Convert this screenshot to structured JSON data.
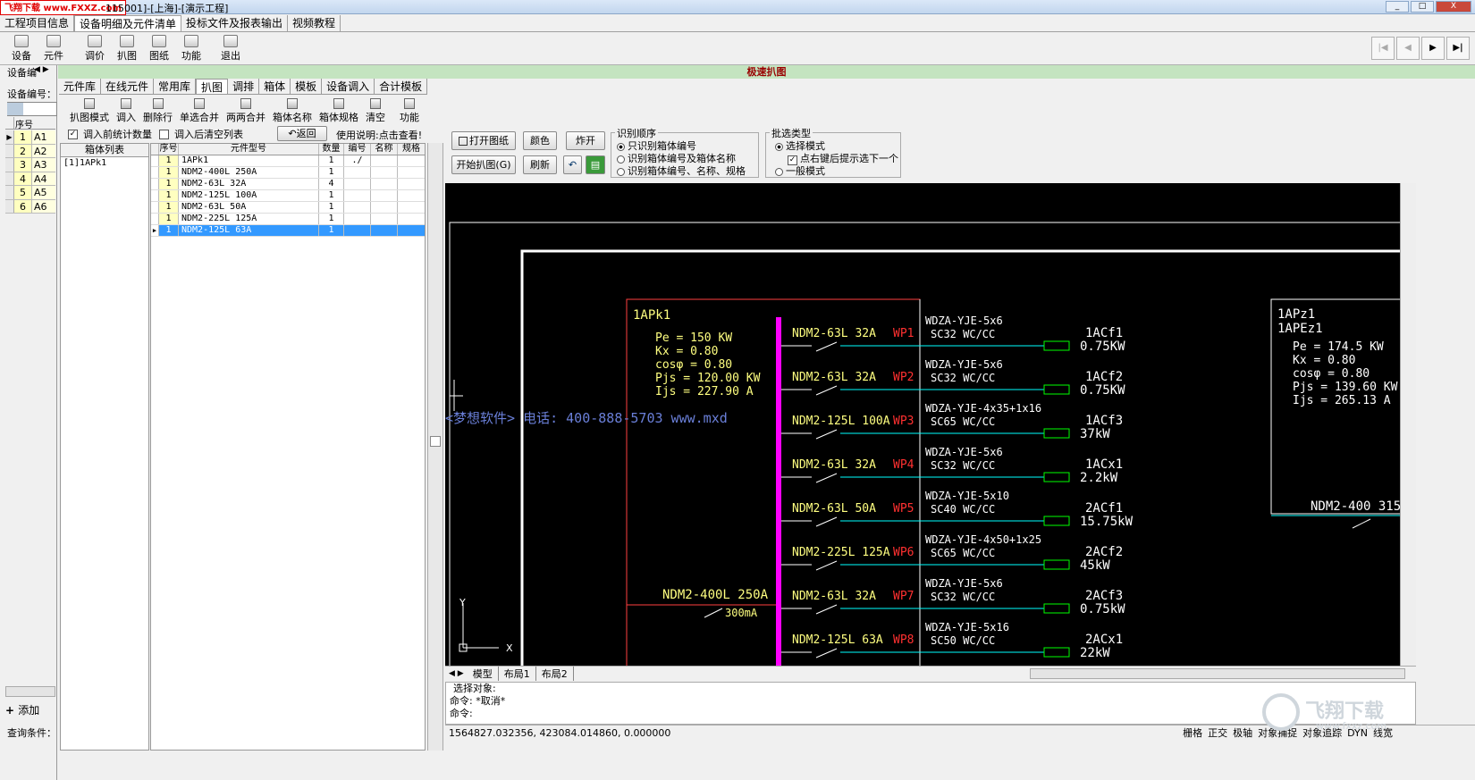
{
  "window": {
    "watermark": "飞翔下载 www.FXXZ.com",
    "title": "115001]-[上海]-[演示工程]",
    "controls": [
      "_",
      "□",
      "X"
    ]
  },
  "menu_tabs": [
    "工程项目信息",
    "设备明细及元件清单",
    "投标文件及报表输出",
    "视频教程"
  ],
  "toolbar": [
    "设备",
    "元件",
    "调价",
    "扒图",
    "图纸",
    "功能",
    "退出"
  ],
  "nav_buttons": [
    "|◀",
    "◀",
    "▶",
    "▶|"
  ],
  "left_panel": {
    "tab_label": "设备编",
    "field_label": "设备编号：",
    "grid_header": "序号",
    "rows": [
      {
        "no": "1",
        "code": "A1"
      },
      {
        "no": "2",
        "code": "A2"
      },
      {
        "no": "3",
        "code": "A3"
      },
      {
        "no": "4",
        "code": "A4"
      },
      {
        "no": "5",
        "code": "A5"
      },
      {
        "no": "6",
        "code": "A6"
      }
    ],
    "add_button": "添加",
    "query_label": "查询条件："
  },
  "green_header": "极速扒图",
  "sub_tabs": [
    "元件库",
    "在线元件",
    "常用库",
    "扒图",
    "调排",
    "箱体",
    "模板",
    "设备调入",
    "合计模板"
  ],
  "sub_toolbar": [
    "扒图模式",
    "调入",
    "删除行",
    "单选合并",
    "两两合并",
    "箱体名称",
    "箱体规格",
    "清空",
    "功能"
  ],
  "options": {
    "count_before_import": "调入前统计数量",
    "clear_after_import": "调入后清空列表",
    "back_button": "返回",
    "usage_hint": "使用说明:点击查看!"
  },
  "box_list": {
    "header": "箱体列表",
    "items": [
      "[1]1APk1"
    ]
  },
  "component_grid": {
    "headers": [
      "序号",
      "元件型号",
      "数量",
      "编号",
      "名称",
      "规格"
    ],
    "rows": [
      {
        "no": "1",
        "model": "1APk1",
        "qty": "1",
        "code": "./",
        "name": "",
        "spec": ""
      },
      {
        "no": "1",
        "model": "NDM2-400L 250A",
        "qty": "1",
        "code": "",
        "name": "",
        "spec": ""
      },
      {
        "no": "1",
        "model": "NDM2-63L 32A",
        "qty": "4",
        "code": "",
        "name": "",
        "spec": ""
      },
      {
        "no": "1",
        "model": "NDM2-125L 100A",
        "qty": "1",
        "code": "",
        "name": "",
        "spec": ""
      },
      {
        "no": "1",
        "model": "NDM2-63L 50A",
        "qty": "1",
        "code": "",
        "name": "",
        "spec": ""
      },
      {
        "no": "1",
        "model": "NDM2-225L 125A",
        "qty": "1",
        "code": "",
        "name": "",
        "spec": ""
      },
      {
        "no": "1",
        "model": "NDM2-125L 63A",
        "qty": "1",
        "code": "",
        "name": "",
        "spec": ""
      }
    ]
  },
  "drawing_controls": {
    "open_drawing": "打开图纸",
    "color": "颜色",
    "explode": "炸开",
    "start_capture": "开始扒图(G)",
    "refresh": "刷新",
    "order_group": "识别顺序",
    "order_options": [
      "只识别箱体编号",
      "识别箱体编号及箱体名称",
      "识别箱体编号、名称、规格"
    ],
    "select_group": "批选类型",
    "select_options": [
      "选择模式",
      "点右键后提示选下一个",
      "一般模式"
    ]
  },
  "cad": {
    "panel_name": "1APk1",
    "params": [
      "Pe = 150 KW",
      "Kx = 0.80",
      "cosφ = 0.80",
      "Pjs = 120.00 KW",
      "Ijs = 227.90 A"
    ],
    "main_breaker": "NDM2-400L 250A",
    "main_rcd": "300mA",
    "circuits": [
      {
        "breaker": "NDM2-63L 32A",
        "code": "WP1",
        "cable": "WDZA-YJE-5x6",
        "conduit": "SC32 WC/CC",
        "load": "1ACf1",
        "power": "0.75KW"
      },
      {
        "breaker": "NDM2-63L 32A",
        "code": "WP2",
        "cable": "WDZA-YJE-5x6",
        "conduit": "SC32 WC/CC",
        "load": "1ACf2",
        "power": "0.75KW"
      },
      {
        "breaker": "NDM2-125L 100A",
        "code": "WP3",
        "cable": "WDZA-YJE-4x35+1x16",
        "conduit": "SC65 WC/CC",
        "load": "1ACf3",
        "power": "37kW"
      },
      {
        "breaker": "NDM2-63L 32A",
        "code": "WP4",
        "cable": "WDZA-YJE-5x6",
        "conduit": "SC32 WC/CC",
        "load": "1ACx1",
        "power": "2.2kW"
      },
      {
        "breaker": "NDM2-63L 50A",
        "code": "WP5",
        "cable": "WDZA-YJE-5x10",
        "conduit": "SC40 WC/CC",
        "load": "2ACf1",
        "power": "15.75kW"
      },
      {
        "breaker": "NDM2-225L 125A",
        "code": "WP6",
        "cable": "WDZA-YJE-4x50+1x25",
        "conduit": "SC65 WC/CC",
        "load": "2ACf2",
        "power": "45kW"
      },
      {
        "breaker": "NDM2-63L 32A",
        "code": "WP7",
        "cable": "WDZA-YJE-5x6",
        "conduit": "SC32 WC/CC",
        "load": "2ACf3",
        "power": "0.75kW"
      },
      {
        "breaker": "NDM2-125L 63A",
        "code": "WP8",
        "cable": "WDZA-YJE-5x16",
        "conduit": "SC50 WC/CC",
        "load": "2ACx1",
        "power": "22kW"
      }
    ],
    "right_panel": {
      "names": [
        "1APz1",
        "1APEz1"
      ],
      "params": [
        "Pe = 174.5 KW",
        "Kx = 0.80",
        "cosφ = 0.80",
        "Pjs = 139.60 KW",
        "Ijs = 265.13 A"
      ],
      "breaker": "NDM2-400 315"
    },
    "watermark": "<梦想软件>  电话: 400-888-5703  www.mxd",
    "axis_y": "Y",
    "axis_x": "X"
  },
  "layout_tabs": [
    "模型",
    "布局1",
    "布局2"
  ],
  "command": {
    "lines": [
      "选择对象:",
      "命令:  *取消*",
      "命令:"
    ]
  },
  "status": {
    "coords": "1564827.032356,  423084.014860,  0.000000",
    "toggles": [
      "栅格",
      "正交",
      "极轴",
      "对象捕捉",
      "对象追踪",
      "DYN",
      "线宽"
    ]
  },
  "logo_text": "飞翔下载",
  "logo_url": "www.fxxz.com",
  "colors": {
    "bus": "#ff00ff",
    "breaker_text": "#ffff80",
    "code_text": "#ff3030",
    "cable_text": "#ffffff",
    "load_box": "#00ff00",
    "feeder_line": "#00ffff",
    "panel_border": "#ff4040",
    "selected_row": "#3399ff"
  }
}
